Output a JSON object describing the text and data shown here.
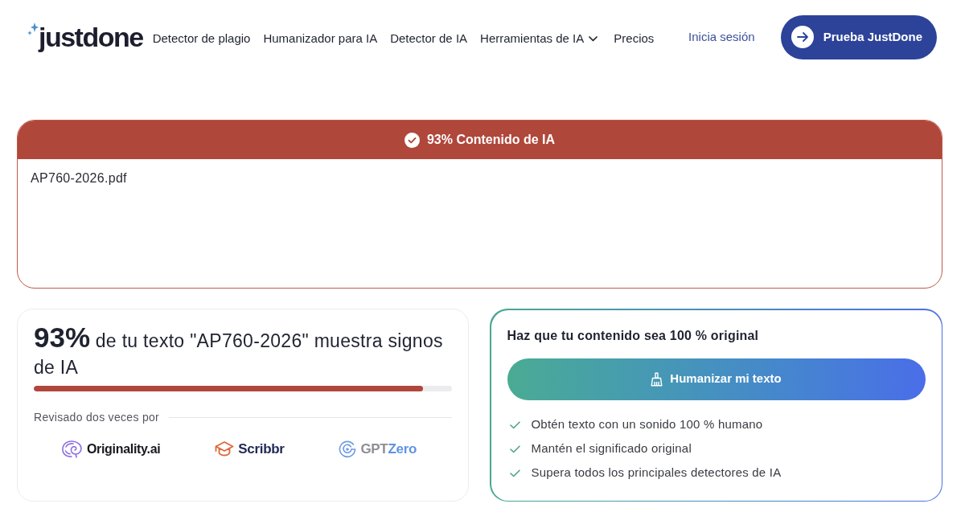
{
  "header": {
    "logo": "justdone",
    "nav": [
      {
        "label": "Detector de plagio",
        "dropdown": false
      },
      {
        "label": "Humanizador para IA",
        "dropdown": false
      },
      {
        "label": "Detector de IA",
        "dropdown": false
      },
      {
        "label": "Herramientas de IA",
        "dropdown": true
      },
      {
        "label": "Precios",
        "dropdown": false
      }
    ],
    "login": "Inicia sesión",
    "cta": "Prueba JustDone"
  },
  "result": {
    "banner": "93% Contenido de IA",
    "file": "AP760-2026.pdf"
  },
  "score": {
    "headline": "**93%** de tu texto \"AP760-2026\" muestra signos de IA",
    "level": 0.93,
    "checked_by": "Revisado dos veces por",
    "detectors": [
      {
        "kind": "brain",
        "parts": [
          "Originality.ai"
        ]
      },
      {
        "kind": "cap",
        "parts": [
          "Scribbr"
        ]
      },
      {
        "kind": "ring",
        "parts": [
          "GPT",
          "Zero"
        ]
      }
    ]
  },
  "humanize": {
    "title": "Haz que tu contenido sea 100 % original",
    "button": "Humanizar mi texto",
    "benefits": [
      "Obtén texto con un sonido 100 % humano",
      "Mantén el significado original",
      "Supera todos los principales detectores de IA"
    ]
  }
}
